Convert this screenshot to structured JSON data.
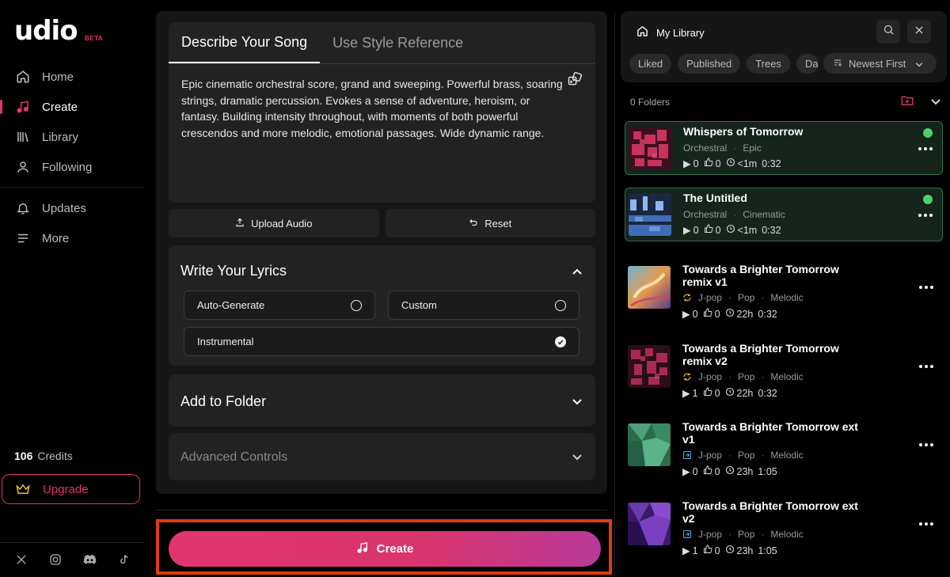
{
  "brand": {
    "name": "udio",
    "badge": "BETA"
  },
  "nav": [
    {
      "label": "Home",
      "icon": "home-icon"
    },
    {
      "label": "Create",
      "icon": "music-note-icon",
      "active": true
    },
    {
      "label": "Library",
      "icon": "library-icon"
    },
    {
      "label": "Following",
      "icon": "person-icon"
    }
  ],
  "nav_secondary": [
    {
      "label": "Updates",
      "icon": "bell-icon"
    },
    {
      "label": "More",
      "icon": "menu-icon"
    }
  ],
  "credits": {
    "count": "106",
    "label": "Credits"
  },
  "upgrade_label": "Upgrade",
  "socials": [
    "x-icon",
    "instagram-icon",
    "discord-icon",
    "tiktok-icon"
  ],
  "create_panel": {
    "tabs": [
      "Describe Your Song",
      "Use Style Reference"
    ],
    "prompt": "Epic cinematic orchestral score, grand and sweeping. Powerful brass, soaring strings, dramatic percussion. Evokes a sense of adventure, heroism, or fantasy. Building intensity throughout, with moments of both powerful crescendos and more melodic, emotional passages. Wide dynamic range.",
    "upload_label": "Upload Audio",
    "reset_label": "Reset",
    "lyrics": {
      "title": "Write Your Lyrics",
      "options": [
        "Auto-Generate",
        "Custom",
        "Instrumental"
      ],
      "selected": "Instrumental"
    },
    "folder_title": "Add to Folder",
    "advanced_title": "Advanced Controls",
    "create_label": "Create"
  },
  "library": {
    "title": "My Library",
    "chips": [
      "Liked",
      "Published",
      "Trees",
      "Da"
    ],
    "sort_label": "Newest First",
    "folders_label": "0 Folders",
    "tracks": [
      {
        "title": "Whispers of Tomorrow",
        "tags": [
          "Orchestral",
          "Epic"
        ],
        "plays": "0",
        "likes": "0",
        "age": "<1m",
        "duration": "0:32",
        "selected": true,
        "status": "ready"
      },
      {
        "title": "The Untitled",
        "tags": [
          "Orchestral",
          "Cinematic"
        ],
        "plays": "0",
        "likes": "0",
        "age": "<1m",
        "duration": "0:32",
        "selected": true,
        "status": "ready"
      },
      {
        "title": "Towards a Brighter Tomorrow remix v1",
        "tags": [
          "J-pop",
          "Pop",
          "Melodic"
        ],
        "plays": "0",
        "likes": "0",
        "age": "22h",
        "duration": "0:32",
        "kind": "remix"
      },
      {
        "title": "Towards a Brighter Tomorrow remix v2",
        "tags": [
          "J-pop",
          "Pop",
          "Melodic"
        ],
        "plays": "1",
        "likes": "0",
        "age": "22h",
        "duration": "0:32",
        "kind": "remix"
      },
      {
        "title": "Towards a Brighter Tomorrow ext v1",
        "tags": [
          "J-pop",
          "Pop",
          "Melodic"
        ],
        "plays": "0",
        "likes": "0",
        "age": "23h",
        "duration": "1:05",
        "kind": "extend"
      },
      {
        "title": "Towards a Brighter Tomorrow ext v2",
        "tags": [
          "J-pop",
          "Pop",
          "Melodic"
        ],
        "plays": "1",
        "likes": "0",
        "age": "23h",
        "duration": "1:05",
        "kind": "extend"
      }
    ]
  },
  "colors": {
    "accent": "#e0356e",
    "highlight_border": "#e23a10",
    "ready": "#4ad36a"
  }
}
